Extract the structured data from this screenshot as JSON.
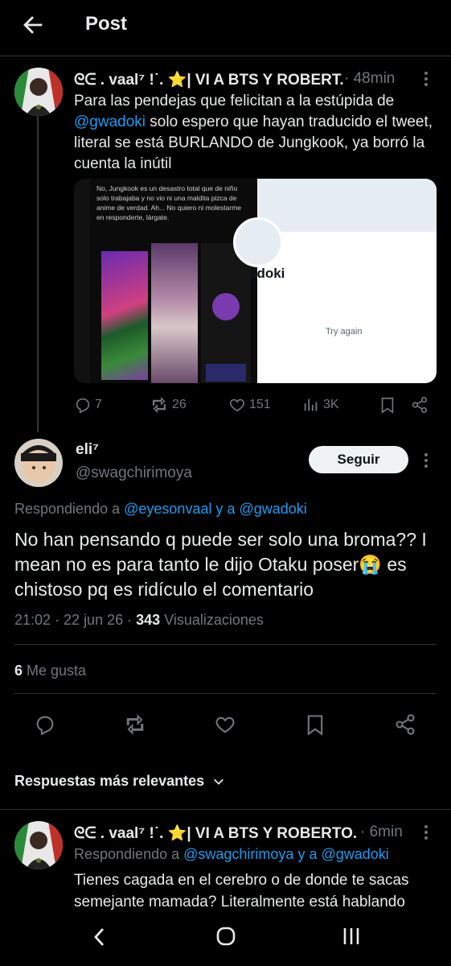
{
  "header": {
    "title": "Post"
  },
  "post1": {
    "author": "ᘓᕮ . vaal⁷ !˙. ⭐| VI A BTS Y ROBERT...",
    "time": "· 48min",
    "text_pre": "Para las pendejas que felicitan a la estúpida de",
    "mention": "@gwadoki",
    "text_post": "solo espero que hayan traducido el tweet, literal se está BURLANDO de Jungkook, ya borró la cuenta la inútil",
    "media": {
      "screenshot_text": "No, Jungkook es un desastro total que de niño solo trabajaba y no vio ni una maldita pizca de anime de verdad. Ah... No quiero ni molestarme en responderte, lárgate.",
      "profile_handle_fragment": "adoki",
      "try_again": "Try again"
    },
    "stats": {
      "replies": "7",
      "retweets": "26",
      "likes": "151",
      "views": "3K"
    }
  },
  "post2": {
    "name": "eli⁷",
    "handle": "@swagchirimoya",
    "follow_label": "Seguir",
    "replying_prefix": "Respondiendo a",
    "replying_users": "@eyesonvaal y a @gwadoki",
    "text": "No han pensando q puede ser solo una broma?? I mean no es para tanto le dijo Otaku poser😭 es chistoso pq es ridículo el comentario",
    "meta_time": "21:02 · 22 jun 26 ·",
    "views_count": "343",
    "views_label": "Visualizaciones",
    "likes_count": "6",
    "likes_label": "Me gusta"
  },
  "sort": {
    "label": "Respuestas más relevantes"
  },
  "post3": {
    "author": "ᘓᕮ . vaal⁷ !˙. ⭐| VI A BTS Y ROBERTO...",
    "time": "· 6min",
    "replying_prefix": "Respondiendo a",
    "replying_users": "@swagchirimoya y a @gwadoki",
    "text": "Tienes cagada en el cerebro o de donde te sacas semejante mamada? Literalmente está hablando"
  },
  "colors": {
    "accent": "#1d9bf0",
    "bg": "#000000",
    "text": "#e7e9ea",
    "muted": "#71767b"
  }
}
